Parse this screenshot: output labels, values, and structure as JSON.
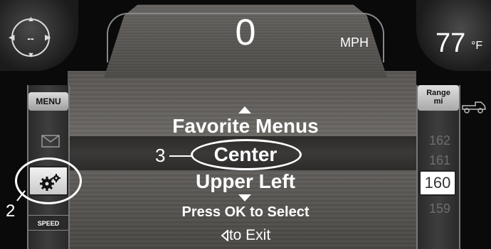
{
  "gauge": {
    "speed_value": "0",
    "speed_unit": "MPH",
    "temperature_value": "77",
    "temperature_unit": "°F",
    "compass_value": "--"
  },
  "left_menu": {
    "menu_label": "MENU",
    "speed_label": "SPEED",
    "icons": [
      "envelope-icon",
      "gear-icon"
    ]
  },
  "right_menu": {
    "range_label_line1": "Range",
    "range_label_line2": "mi",
    "scale_values": [
      "162",
      "161",
      "159"
    ],
    "current_range": "160",
    "icons": [
      "truck-icon"
    ]
  },
  "center_menu": {
    "previous_item": "Favorite Menus",
    "selected_item": "Center",
    "next_item": "Upper Left",
    "instruction": "Press OK to Select",
    "exit_label": "to Exit"
  },
  "callouts": {
    "settings_label": "2",
    "center_label": "3"
  },
  "colors": {
    "text": "#ffffff",
    "background": "#0a0a0a",
    "highlight": "#2c2b2a"
  }
}
